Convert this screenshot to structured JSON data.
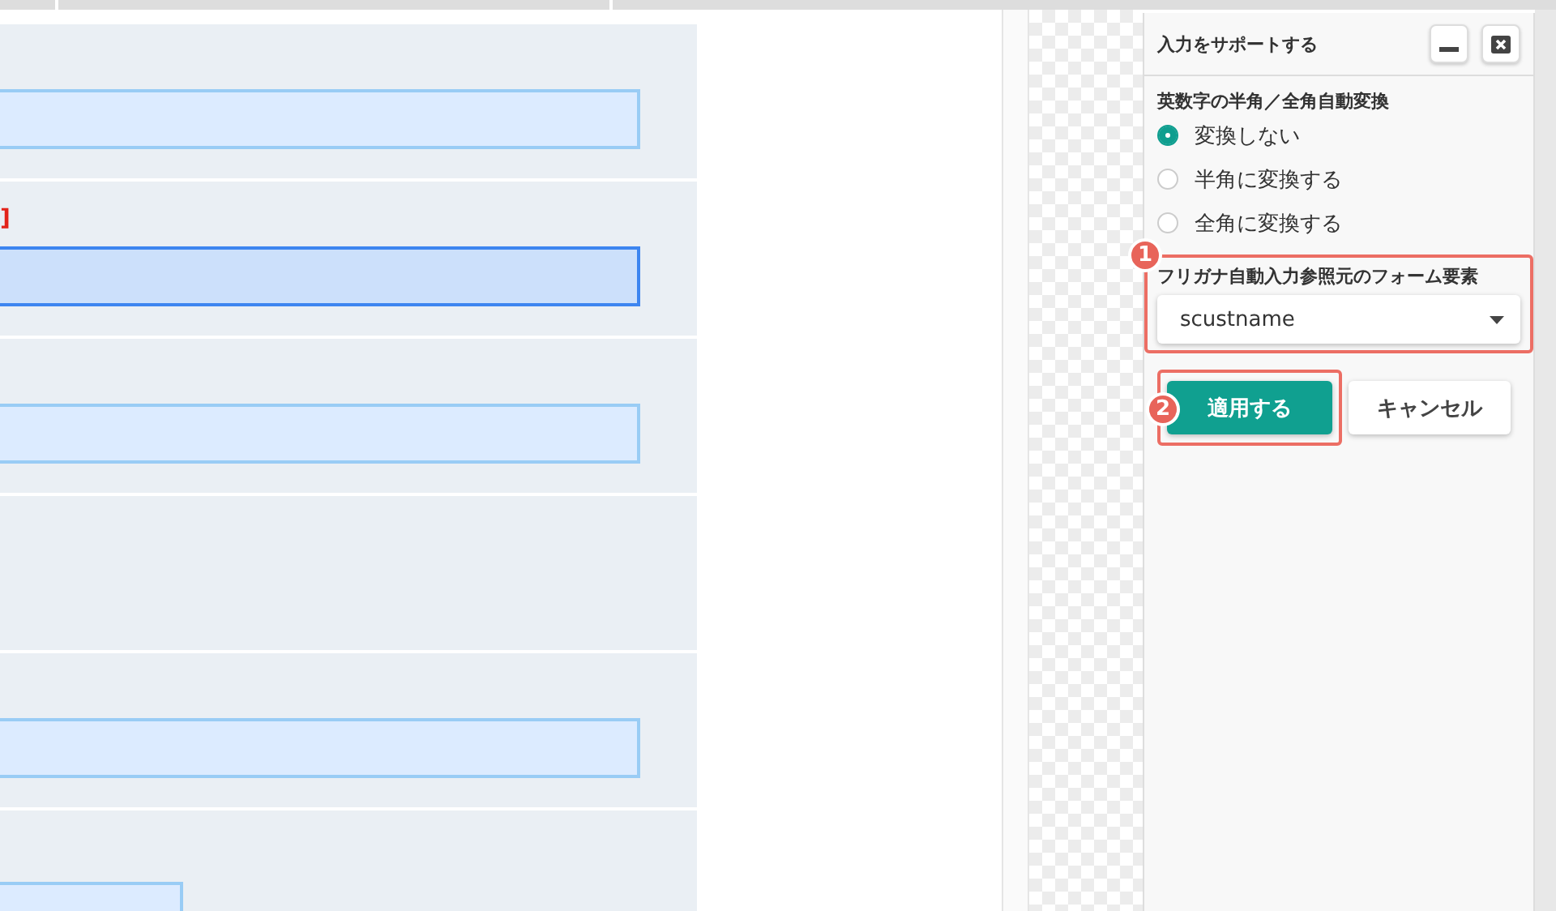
{
  "form": {
    "rows": [
      {
        "note": null,
        "field": {
          "focused": false,
          "short": false
        }
      },
      {
        "note": "]",
        "field": {
          "focused": true,
          "short": false
        }
      },
      {
        "note": null,
        "field": {
          "focused": false,
          "short": false
        }
      },
      {
        "note": null,
        "field": null
      },
      {
        "note": null,
        "field": {
          "focused": false,
          "short": false
        }
      },
      {
        "note": null,
        "field": {
          "focused": false,
          "short": true
        }
      }
    ]
  },
  "panel": {
    "title": "入力をサポートする",
    "conversion": {
      "label": "英数字の半角／全角自動変換",
      "options": [
        {
          "label": "変換しない",
          "selected": true
        },
        {
          "label": "半角に変換する",
          "selected": false
        },
        {
          "label": "全角に変換する",
          "selected": false
        }
      ]
    },
    "furigana": {
      "badge": "1",
      "label": "フリガナ自動入力参照元のフォーム要素",
      "value": "scustname"
    },
    "buttons": [
      {
        "label": "適用する",
        "kind": "primary",
        "badge": "2"
      },
      {
        "label": "キャンセル",
        "kind": "secondary"
      }
    ]
  }
}
